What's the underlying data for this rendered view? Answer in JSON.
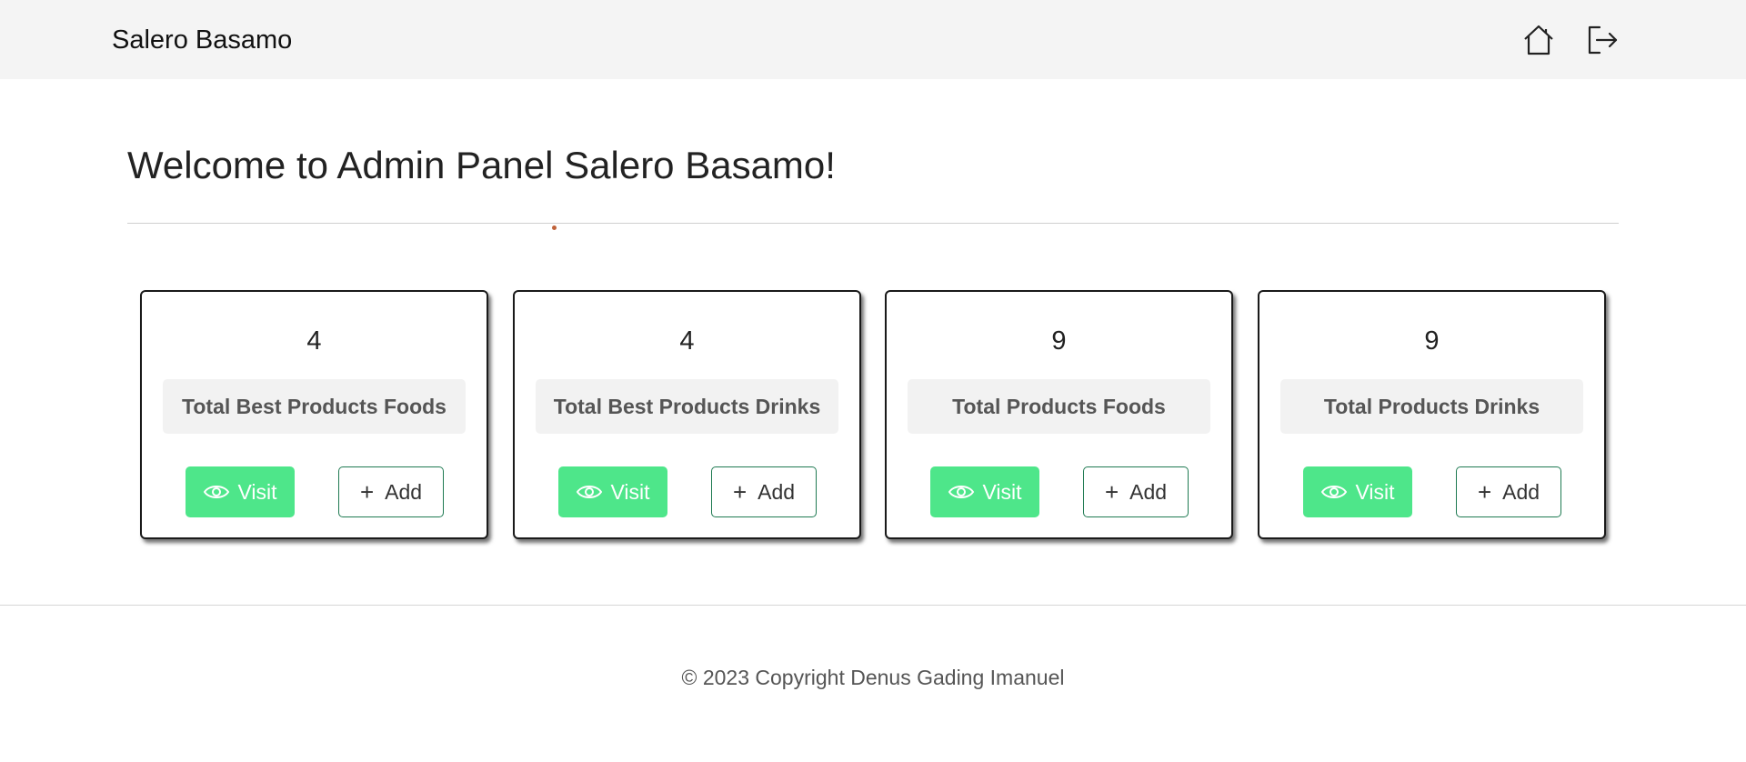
{
  "navbar": {
    "brand": "Salero Basamo",
    "icons": [
      "home-icon",
      "logout-icon"
    ]
  },
  "main": {
    "title": "Welcome to Admin Panel Salero Basamo!"
  },
  "cards": [
    {
      "value": "4",
      "label": "Total Best Products Foods",
      "visit_label": "Visit",
      "add_label": "Add"
    },
    {
      "value": "4",
      "label": "Total Best Products Drinks",
      "visit_label": "Visit",
      "add_label": "Add"
    },
    {
      "value": "9",
      "label": "Total Products Foods",
      "visit_label": "Visit",
      "add_label": "Add"
    },
    {
      "value": "9",
      "label": "Total Products Drinks",
      "visit_label": "Visit",
      "add_label": "Add"
    }
  ],
  "colors": {
    "navbar_bg": "#f4f4f4",
    "visit_button": "#4ee68a",
    "add_border": "#1f7a52"
  },
  "footer": {
    "copyright": "© 2023 Copyright Denus Gading Imanuel"
  }
}
